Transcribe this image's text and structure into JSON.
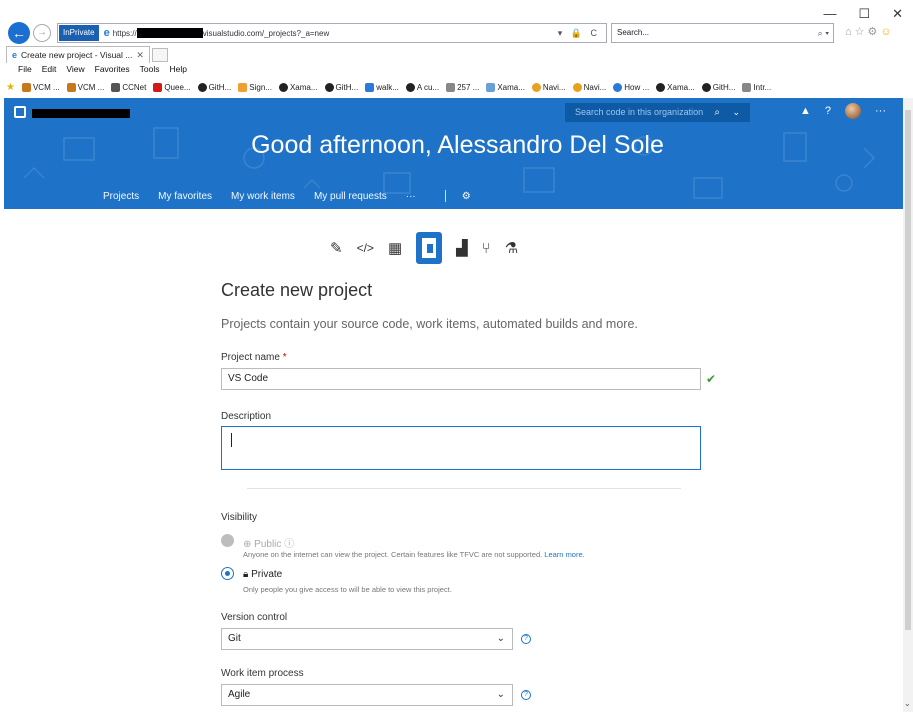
{
  "window": {
    "minimize": "—",
    "maximize": "☐",
    "close": "✕"
  },
  "address_bar": {
    "inprivate": "InPrivate",
    "url_scheme": "https://",
    "url_rest": "visualstudio.com/_projects?_a=new",
    "actions": "▾ 🔒 C"
  },
  "search_bar": {
    "value": "Search...",
    "go": "⌕ ▾"
  },
  "tab": {
    "label": "Create new project - Visual ...",
    "close": "✕"
  },
  "menu": [
    "File",
    "Edit",
    "View",
    "Favorites",
    "Tools",
    "Help"
  ],
  "favorites": [
    {
      "label": "VCM ...",
      "color": "#c8781a"
    },
    {
      "label": "VCM ...",
      "color": "#c8781a"
    },
    {
      "label": "CCNet",
      "color": "#555555"
    },
    {
      "label": "Quee...",
      "color": "#d11a1a"
    },
    {
      "label": "GitH...",
      "color": "#222222"
    },
    {
      "label": "Sign...",
      "color": "#f0a030"
    },
    {
      "label": "Xama...",
      "color": "#222222"
    },
    {
      "label": "GitH...",
      "color": "#222222"
    },
    {
      "label": "walk...",
      "color": "#2a7ad8"
    },
    {
      "label": "A cu...",
      "color": "#222222"
    },
    {
      "label": "257 ...",
      "color": "#888888"
    },
    {
      "label": "Xama...",
      "color": "#6aa0d8"
    },
    {
      "label": "Navi...",
      "color": "#e8a020"
    },
    {
      "label": "Navi...",
      "color": "#e8a020"
    },
    {
      "label": "How ...",
      "color": "#2a7ad8"
    },
    {
      "label": "Xama...",
      "color": "#222222"
    },
    {
      "label": "GitH...",
      "color": "#222222"
    },
    {
      "label": "Intr...",
      "color": "#888888"
    }
  ],
  "devops": {
    "search_placeholder": "Search code in this organization",
    "greeting": "Good afternoon, Alessandro Del Sole",
    "hubs": [
      "Projects",
      "My favorites",
      "My work items",
      "My pull requests",
      "···"
    ],
    "accent": "#1e73c8"
  },
  "form": {
    "title": "Create new project",
    "subtitle": "Projects contain your source code, work items, automated builds and more.",
    "project_name_label": "Project name",
    "required_mark": "*",
    "project_name_value": "VS Code",
    "description_label": "Description",
    "visibility_label": "Visibility",
    "public_label": "Public",
    "public_help": "Anyone on the internet can view the project. Certain features like TFVC are not supported.",
    "learn_more": "Learn more.",
    "private_label": "Private",
    "private_help": "Only people you give access to will be able to view this project.",
    "version_control_label": "Version control",
    "version_control_value": "Git",
    "work_item_label": "Work item process",
    "work_item_value": "Agile"
  }
}
